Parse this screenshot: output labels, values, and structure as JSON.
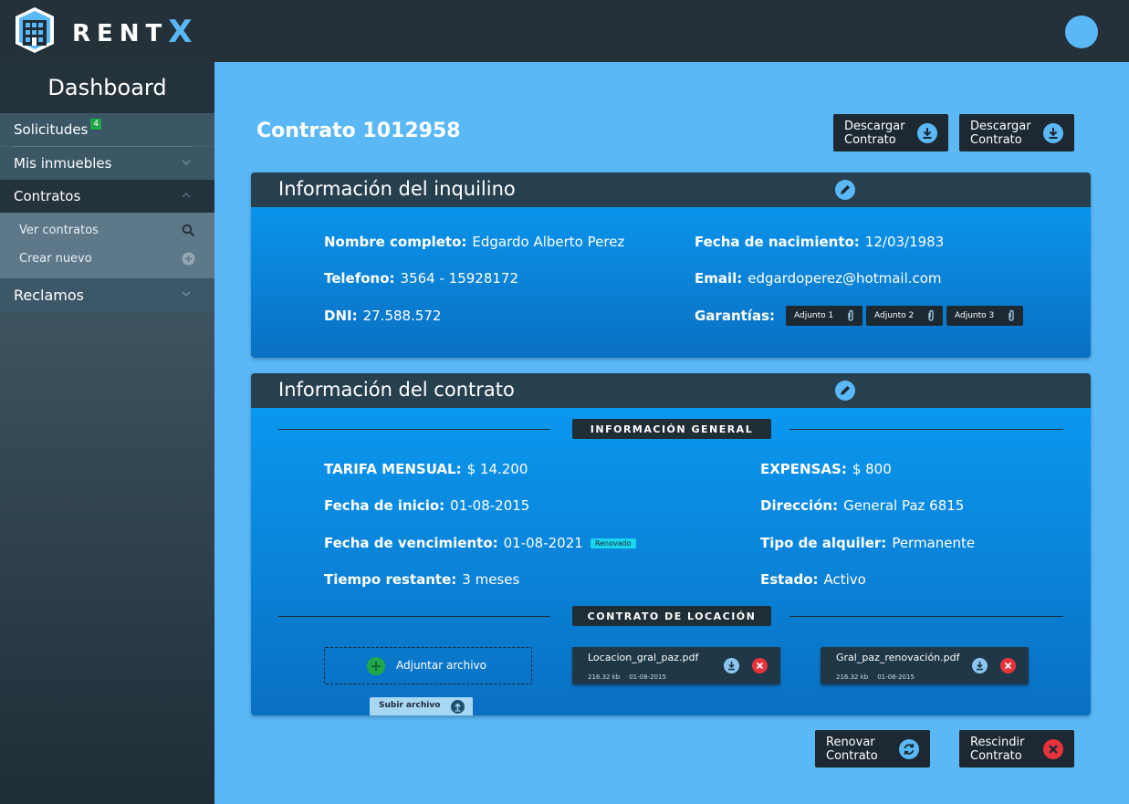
{
  "app": {
    "brand_prefix": "RENT",
    "brand_x": "X"
  },
  "sidebar": {
    "title": "Dashboard",
    "items": [
      {
        "label": "Solicitudes",
        "badge": "4"
      },
      {
        "label": "Mis inmuebles"
      },
      {
        "label": "Contratos"
      },
      {
        "label": "Reclamos"
      }
    ],
    "sub_items": [
      {
        "label": "Ver contratos",
        "icon": "search-icon"
      },
      {
        "label": "Crear nuevo",
        "icon": "plus-circle-icon"
      }
    ]
  },
  "header": {
    "title": "Contrato 1012958",
    "buttons": [
      {
        "label_line1": "Descargar",
        "label_line2": "Contrato"
      },
      {
        "label_line1": "Descargar",
        "label_line2": "Contrato"
      }
    ]
  },
  "tenant": {
    "title": "Información del inquilino",
    "name_label": "Nombre completo:",
    "name": "Edgardo Alberto Perez",
    "phone_label": "Telefono:",
    "phone": "3564 - 15928172",
    "dni_label": "DNI:",
    "dni": "27.588.572",
    "birth_label": "Fecha de nacimiento:",
    "birth": "12/03/1983",
    "email_label": "Email:",
    "email": "edgardoperez@hotmail.com",
    "guarantees_label": "Garantías:",
    "attachments": [
      "Adjunto 1",
      "Adjunto 2",
      "Adjunto 3"
    ]
  },
  "contract": {
    "title": "Información del contrato",
    "section_general": "INFORMACIÓN GENERAL",
    "fee_label": "TARIFA MENSUAL:",
    "fee": "$ 14.200",
    "start_label": "Fecha de inicio:",
    "start": "01-08-2015",
    "end_label": "Fecha de vencimiento:",
    "end": "01-08-2021",
    "renewed_badge": "Renovado",
    "remaining_label": "Tiempo restante:",
    "remaining": "3 meses",
    "expenses_label": "EXPENSAS:",
    "expenses": "$ 800",
    "address_label": "Dirección:",
    "address": "General Paz 6815",
    "rental_type_label": "Tipo de alquiler:",
    "rental_type": "Permanente",
    "status_label": "Estado:",
    "status": "Activo",
    "section_lease": "CONTRATO DE LOCACIÓN",
    "attach_label": "Adjuntar archivo",
    "upload_label": "Subir archivo",
    "files": [
      {
        "name": "Locacion_gral_paz.pdf",
        "size": "216.32 kb",
        "date": "01-08-2015"
      },
      {
        "name": "Gral_paz_renovación.pdf",
        "size": "216.32 kb",
        "date": "01-08-2015"
      }
    ]
  },
  "actions": {
    "renew_line1": "Renovar",
    "renew_line2": "Contrato",
    "rescind_line1": "Rescindir",
    "rescind_line2": "Contrato"
  },
  "colors": {
    "background": "#5ab8f7",
    "topbar": "#243139",
    "accent": "#5ab8f7",
    "success": "#1fa74a",
    "danger": "#e8333d",
    "renewed": "#1ad4f0"
  }
}
